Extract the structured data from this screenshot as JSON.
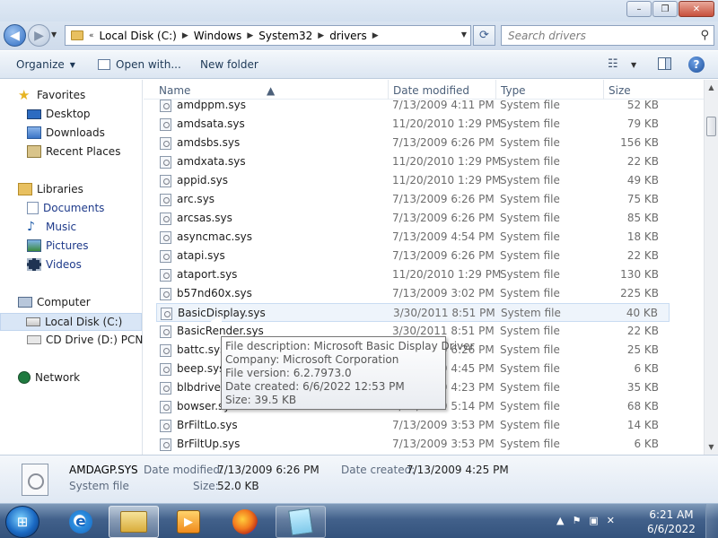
{
  "window": {
    "caption_buttons": {
      "minimize": "–",
      "restore": "❐",
      "close": "✕"
    }
  },
  "address": {
    "prefix": "«",
    "crumbs": [
      "Local Disk (C:)",
      "Windows",
      "System32",
      "drivers"
    ],
    "search_placeholder": "Search drivers"
  },
  "toolbar": {
    "organize": "Organize",
    "open_with": "Open with...",
    "new_folder": "New folder"
  },
  "nav": {
    "favorites": "Favorites",
    "desktop": "Desktop",
    "downloads": "Downloads",
    "recent_places": "Recent Places",
    "libraries": "Libraries",
    "documents": "Documents",
    "music": "Music",
    "pictures": "Pictures",
    "videos": "Videos",
    "computer": "Computer",
    "local_disk": "Local Disk (C:)",
    "cd_drive": "CD Drive (D:) PCNet",
    "network": "Network"
  },
  "columns": {
    "name": "Name",
    "date_modified": "Date modified",
    "type": "Type",
    "size": "Size"
  },
  "files": [
    {
      "name": "amdppm.sys",
      "date": "7/13/2009 4:11 PM",
      "type": "System file",
      "size": "52 KB"
    },
    {
      "name": "amdsata.sys",
      "date": "11/20/2010 1:29 PM",
      "type": "System file",
      "size": "79 KB"
    },
    {
      "name": "amdsbs.sys",
      "date": "7/13/2009 6:26 PM",
      "type": "System file",
      "size": "156 KB"
    },
    {
      "name": "amdxata.sys",
      "date": "11/20/2010 1:29 PM",
      "type": "System file",
      "size": "22 KB"
    },
    {
      "name": "appid.sys",
      "date": "11/20/2010 1:29 PM",
      "type": "System file",
      "size": "49 KB"
    },
    {
      "name": "arc.sys",
      "date": "7/13/2009 6:26 PM",
      "type": "System file",
      "size": "75 KB"
    },
    {
      "name": "arcsas.sys",
      "date": "7/13/2009 6:26 PM",
      "type": "System file",
      "size": "85 KB"
    },
    {
      "name": "asyncmac.sys",
      "date": "7/13/2009 4:54 PM",
      "type": "System file",
      "size": "18 KB"
    },
    {
      "name": "atapi.sys",
      "date": "7/13/2009 6:26 PM",
      "type": "System file",
      "size": "22 KB"
    },
    {
      "name": "ataport.sys",
      "date": "11/20/2010 1:29 PM",
      "type": "System file",
      "size": "130 KB"
    },
    {
      "name": "b57nd60x.sys",
      "date": "7/13/2009 3:02 PM",
      "type": "System file",
      "size": "225 KB"
    },
    {
      "name": "BasicDisplay.sys",
      "date": "3/30/2011 8:51 PM",
      "type": "System file",
      "size": "40 KB"
    },
    {
      "name": "BasicRender.sys",
      "date": "3/30/2011 8:51 PM",
      "type": "System file",
      "size": "22 KB"
    },
    {
      "name": "battc.sys",
      "date": "7/13/2009 6:26 PM",
      "type": "System file",
      "size": "25 KB"
    },
    {
      "name": "beep.sys",
      "date": "7/13/2009 4:45 PM",
      "type": "System file",
      "size": "6 KB"
    },
    {
      "name": "blbdrive.sys",
      "date": "7/13/2009 4:23 PM",
      "type": "System file",
      "size": "35 KB"
    },
    {
      "name": "bowser.sys",
      "date": "7/13/2009 5:14 PM",
      "type": "System file",
      "size": "68 KB"
    },
    {
      "name": "BrFiltLo.sys",
      "date": "7/13/2009 3:53 PM",
      "type": "System file",
      "size": "14 KB"
    },
    {
      "name": "BrFiltUp.sys",
      "date": "7/13/2009 3:53 PM",
      "type": "System file",
      "size": "6 KB"
    }
  ],
  "tooltip": {
    "line1": "File description: Microsoft Basic Display Driver",
    "line2": "Company: Microsoft Corporation",
    "line3": "File version: 6.2.7973.0",
    "line4": "Date created: 6/6/2022 12:53 PM",
    "line5": "Size: 39.5 KB"
  },
  "details": {
    "filename": "AMDAGP.SYS",
    "date_modified_label": "Date modified:",
    "date_modified_value": "7/13/2009 6:26 PM",
    "date_created_label": "Date created:",
    "date_created_value": "7/13/2009 4:25 PM",
    "type_value": "System file",
    "size_label": "Size:",
    "size_value": "52.0 KB"
  },
  "taskbar": {
    "time": "6:21 AM",
    "date": "6/6/2022"
  }
}
